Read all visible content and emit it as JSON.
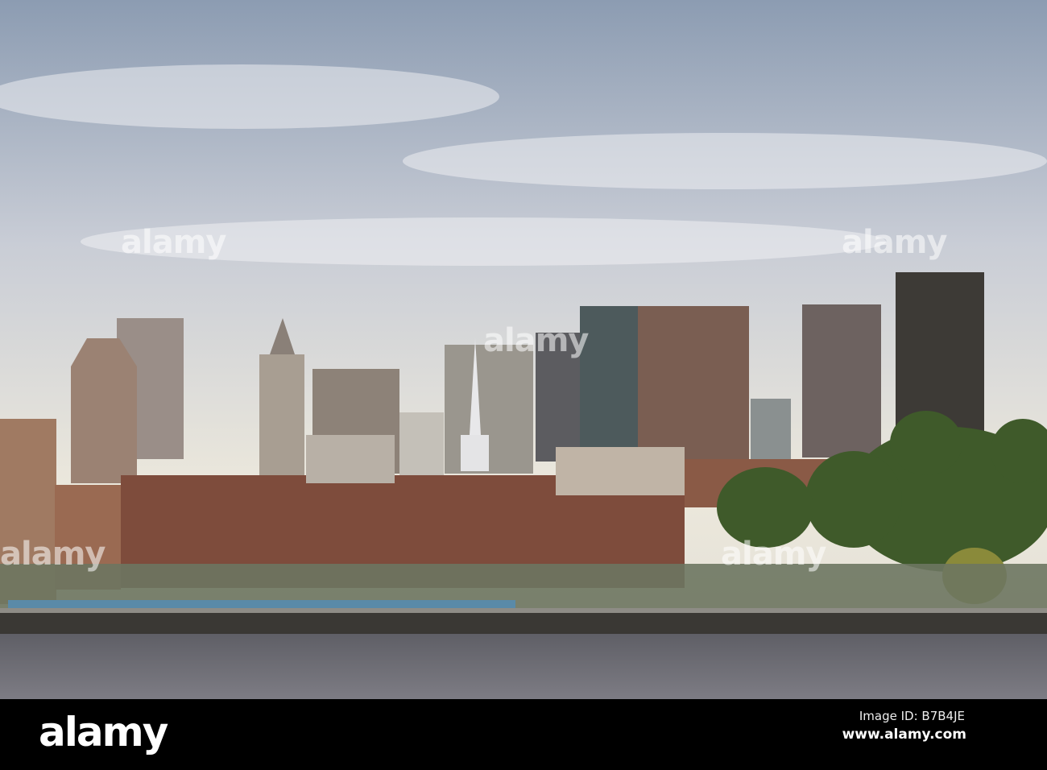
{
  "photo": {
    "subject": "city-skyline-waterfront"
  },
  "watermark": {
    "text": "alamy"
  },
  "footer": {
    "logo": "alamy",
    "image_id_label": "Image ID: B7B4JE",
    "url": "www.alamy.com"
  },
  "colors": {
    "sky_top": "#8f9fb4",
    "sky_bottom": "#e8e4d8",
    "water": "#6f6f78",
    "bar": "#000000"
  }
}
